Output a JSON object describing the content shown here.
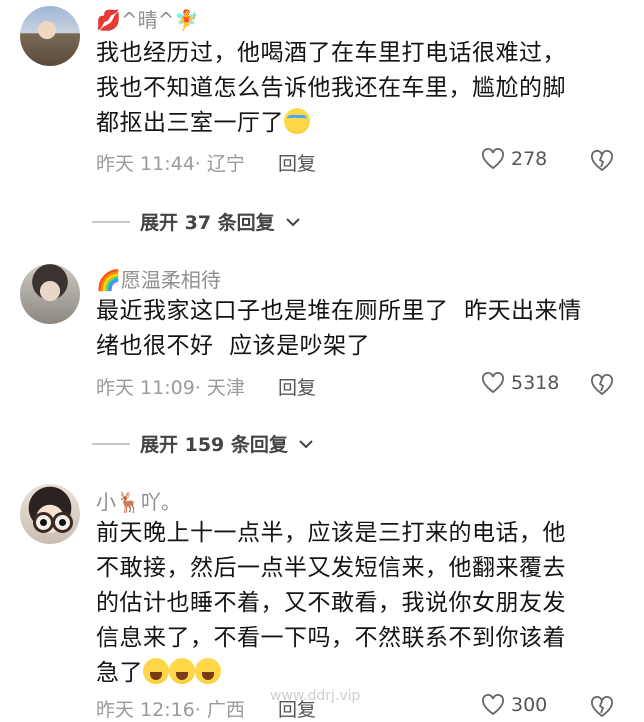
{
  "comments": [
    {
      "username": "💋^晴^🧚",
      "text": "我也经历过，他喝酒了在车里打电话很难过，\n我也不知道怎么告诉他我还在车里，尴尬的脚\n都抠出三室一厅了",
      "emoji": "😫",
      "time": "昨天 11:44",
      "location": "· 辽宁",
      "reply_label": "回复",
      "likes": "278",
      "expand_label": "展开 37 条回复"
    },
    {
      "username": "🌈愿温柔相待",
      "text": "最近我家这口子也是堆在厕所里了  昨天出来情\n绪也很不好  应该是吵架了",
      "time": "昨天 11:09",
      "location": "· 天津",
      "reply_label": "回复",
      "likes": "5318",
      "expand_label": "展开 159 条回复"
    },
    {
      "username": "小🦌吖。",
      "text": "前天晚上十一点半，应该是三打来的电话，他\n不敢接，然后一点半又发短信来，他翻来覆去\n的估计也睡不着，又不敢看，我说你女朋友发\n信息来了，不看一下吗，不然联系不到你该着\n急了",
      "emoji": "😂😂😂",
      "time": "昨天 12:16",
      "location": "· 广西",
      "reply_label": "回复",
      "likes": "300"
    }
  ],
  "watermark": "www.ddrj.vip",
  "icons": {
    "like": "heart-outline-icon",
    "dislike": "broken-heart-icon",
    "expand": "chevron-down-icon"
  }
}
